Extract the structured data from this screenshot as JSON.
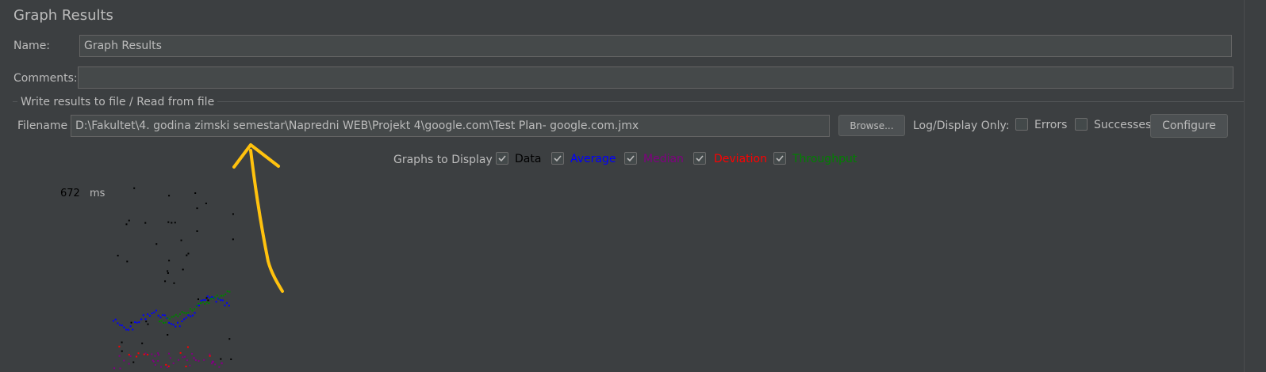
{
  "panel": {
    "title": "Graph Results"
  },
  "name_field": {
    "label": "Name:",
    "value": "Graph Results"
  },
  "comments_field": {
    "label": "Comments:",
    "value": ""
  },
  "file_section": {
    "title": "Write results to file / Read from file",
    "filename_label": "Filename",
    "filename_value": "D:\\Fakultet\\4. godina zimski semestar\\Napredni WEB\\Projekt 4\\google.com\\Test Plan- google.com.jmx",
    "browse_label": "Browse...",
    "log_display_label": "Log/Display Only:",
    "errors_label": "Errors",
    "errors_checked": false,
    "successes_label": "Successes",
    "successes_checked": false,
    "configure_label": "Configure"
  },
  "graphs_to_display": {
    "label": "Graphs to Display",
    "options": [
      {
        "label": "Data",
        "checked": true,
        "color": "#000000"
      },
      {
        "label": "Average",
        "checked": true,
        "color": "#0000ff"
      },
      {
        "label": "Median",
        "checked": true,
        "color": "#800080"
      },
      {
        "label": "Deviation",
        "checked": true,
        "color": "#ff0000"
      },
      {
        "label": "Throughput",
        "checked": true,
        "color": "#008000"
      }
    ]
  },
  "graph": {
    "y_max_value": "672",
    "y_unit": "ms"
  },
  "annotation": {
    "color": "#ffc20e",
    "shape": "hand-drawn arrow pointing up at filename field"
  },
  "colors": {
    "background": "#3c3f41",
    "field_background": "#45494a",
    "text": "#bbbbbb"
  }
}
